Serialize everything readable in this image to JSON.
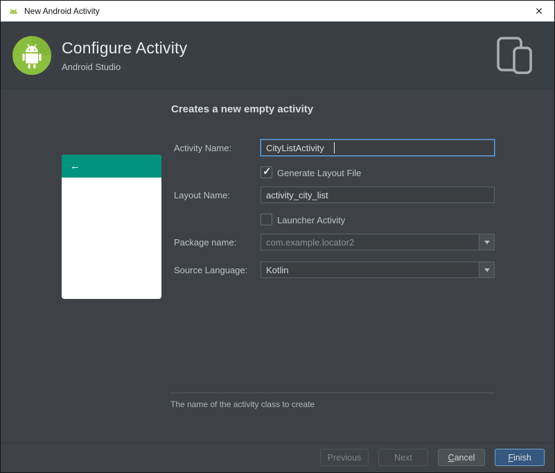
{
  "window": {
    "title": "New Android Activity",
    "close_glyph": "✕"
  },
  "header": {
    "title": "Configure Activity",
    "subtitle": "Android Studio"
  },
  "content": {
    "heading": "Creates a new empty activity",
    "preview": {
      "back_glyph": "←"
    },
    "fields": {
      "activity_name": {
        "label": "Activity Name:",
        "value": "CityListActivity"
      },
      "generate_layout": {
        "label": "Generate Layout File",
        "checked": true
      },
      "layout_name": {
        "label": "Layout Name:",
        "value": "activity_city_list"
      },
      "launcher_activity": {
        "label": "Launcher Activity",
        "checked": false
      },
      "package_name": {
        "label": "Package name:",
        "value": "com.example.locator2"
      },
      "source_language": {
        "label": "Source Language:",
        "value": "Kotlin"
      }
    },
    "helper_text": "The name of the activity class to create"
  },
  "footer": {
    "previous_label": "Previous",
    "next_label": "Next",
    "cancel_label": "Cancel",
    "finish_label": "Finish"
  },
  "colors": {
    "appbar_teal": "#00947e",
    "focus_blue": "#3c6ea5",
    "finish_blue": "#365880",
    "android_green": "#8bbf3e"
  }
}
